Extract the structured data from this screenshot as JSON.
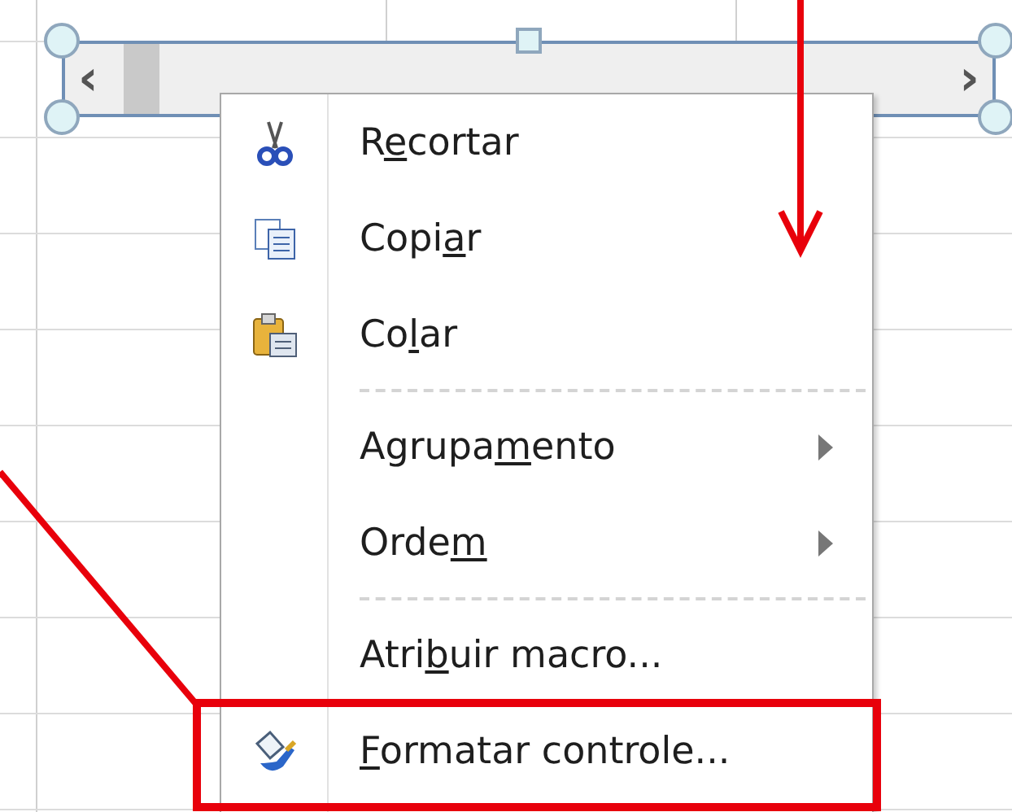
{
  "scrollbar": {
    "selected": true,
    "left_arrow": "‹",
    "right_arrow": "›"
  },
  "context_menu": {
    "items": [
      {
        "kind": "command",
        "before": "R",
        "key": "e",
        "after": "cortar"
      },
      {
        "kind": "command",
        "before": "Copi",
        "key": "a",
        "after": "r"
      },
      {
        "kind": "command",
        "before": "Co",
        "key": "l",
        "after": "ar"
      },
      {
        "kind": "separator"
      },
      {
        "kind": "submenu",
        "before": "Agrupa",
        "key": "m",
        "after": "ento"
      },
      {
        "kind": "submenu",
        "before": "Orde",
        "key": "m"
      },
      {
        "kind": "separator"
      },
      {
        "kind": "command",
        "before": "Atri",
        "key": "b",
        "after": "uir macro..."
      },
      {
        "kind": "command",
        "key": "F",
        "after": "ormatar controle..."
      }
    ]
  }
}
